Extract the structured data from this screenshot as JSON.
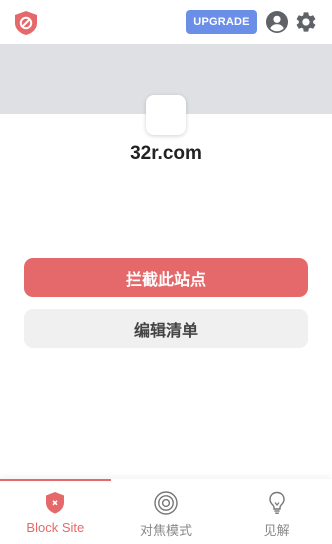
{
  "header": {
    "logo_icon": "shield-block-icon",
    "upgrade_label": "UPGRADE",
    "account_icon": "account-circle-icon",
    "settings_icon": "gear-icon"
  },
  "site": {
    "domain": "32r.com",
    "favicon_icon": "blank-favicon"
  },
  "actions": {
    "block_label": "拦截此站点",
    "edit_list_label": "编辑清单"
  },
  "bottom_nav": {
    "items": [
      {
        "label": "Block Site",
        "icon": "shield-x-icon",
        "active": true
      },
      {
        "label": "对焦模式",
        "icon": "target-icon",
        "active": false
      },
      {
        "label": "见解",
        "icon": "lightbulb-icon",
        "active": false
      }
    ]
  },
  "colors": {
    "accent": "#e5696b",
    "upgrade": "#6b8fe8",
    "banner": "#dfe0e4"
  }
}
